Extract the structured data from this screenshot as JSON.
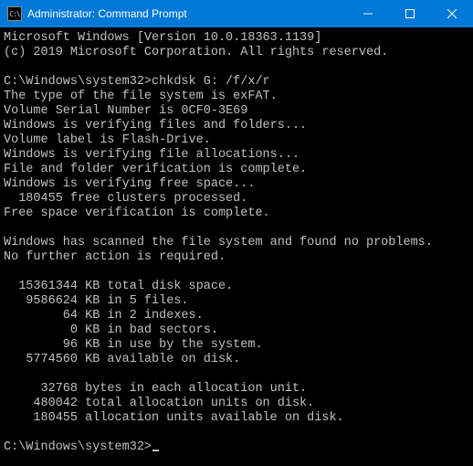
{
  "window": {
    "title": "Administrator: Command Prompt",
    "icon_text": "C:\\"
  },
  "terminal": {
    "lines": [
      "Microsoft Windows [Version 10.0.18363.1139]",
      "(c) 2019 Microsoft Corporation. All rights reserved.",
      "",
      "C:\\Windows\\system32>chkdsk G: /f/x/r",
      "The type of the file system is exFAT.",
      "Volume Serial Number is 0CF0-3E69",
      "Windows is verifying files and folders...",
      "Volume label is Flash-Drive.",
      "Windows is verifying file allocations...",
      "File and folder verification is complete.",
      "Windows is verifying free space...",
      "  180455 free clusters processed.",
      "Free space verification is complete.",
      "",
      "Windows has scanned the file system and found no problems.",
      "No further action is required.",
      "",
      "  15361344 KB total disk space.",
      "   9586624 KB in 5 files.",
      "        64 KB in 2 indexes.",
      "         0 KB in bad sectors.",
      "        96 KB in use by the system.",
      "   5774560 KB available on disk.",
      "",
      "     32768 bytes in each allocation unit.",
      "    480042 total allocation units on disk.",
      "    180455 allocation units available on disk.",
      "",
      "C:\\Windows\\system32>"
    ]
  }
}
